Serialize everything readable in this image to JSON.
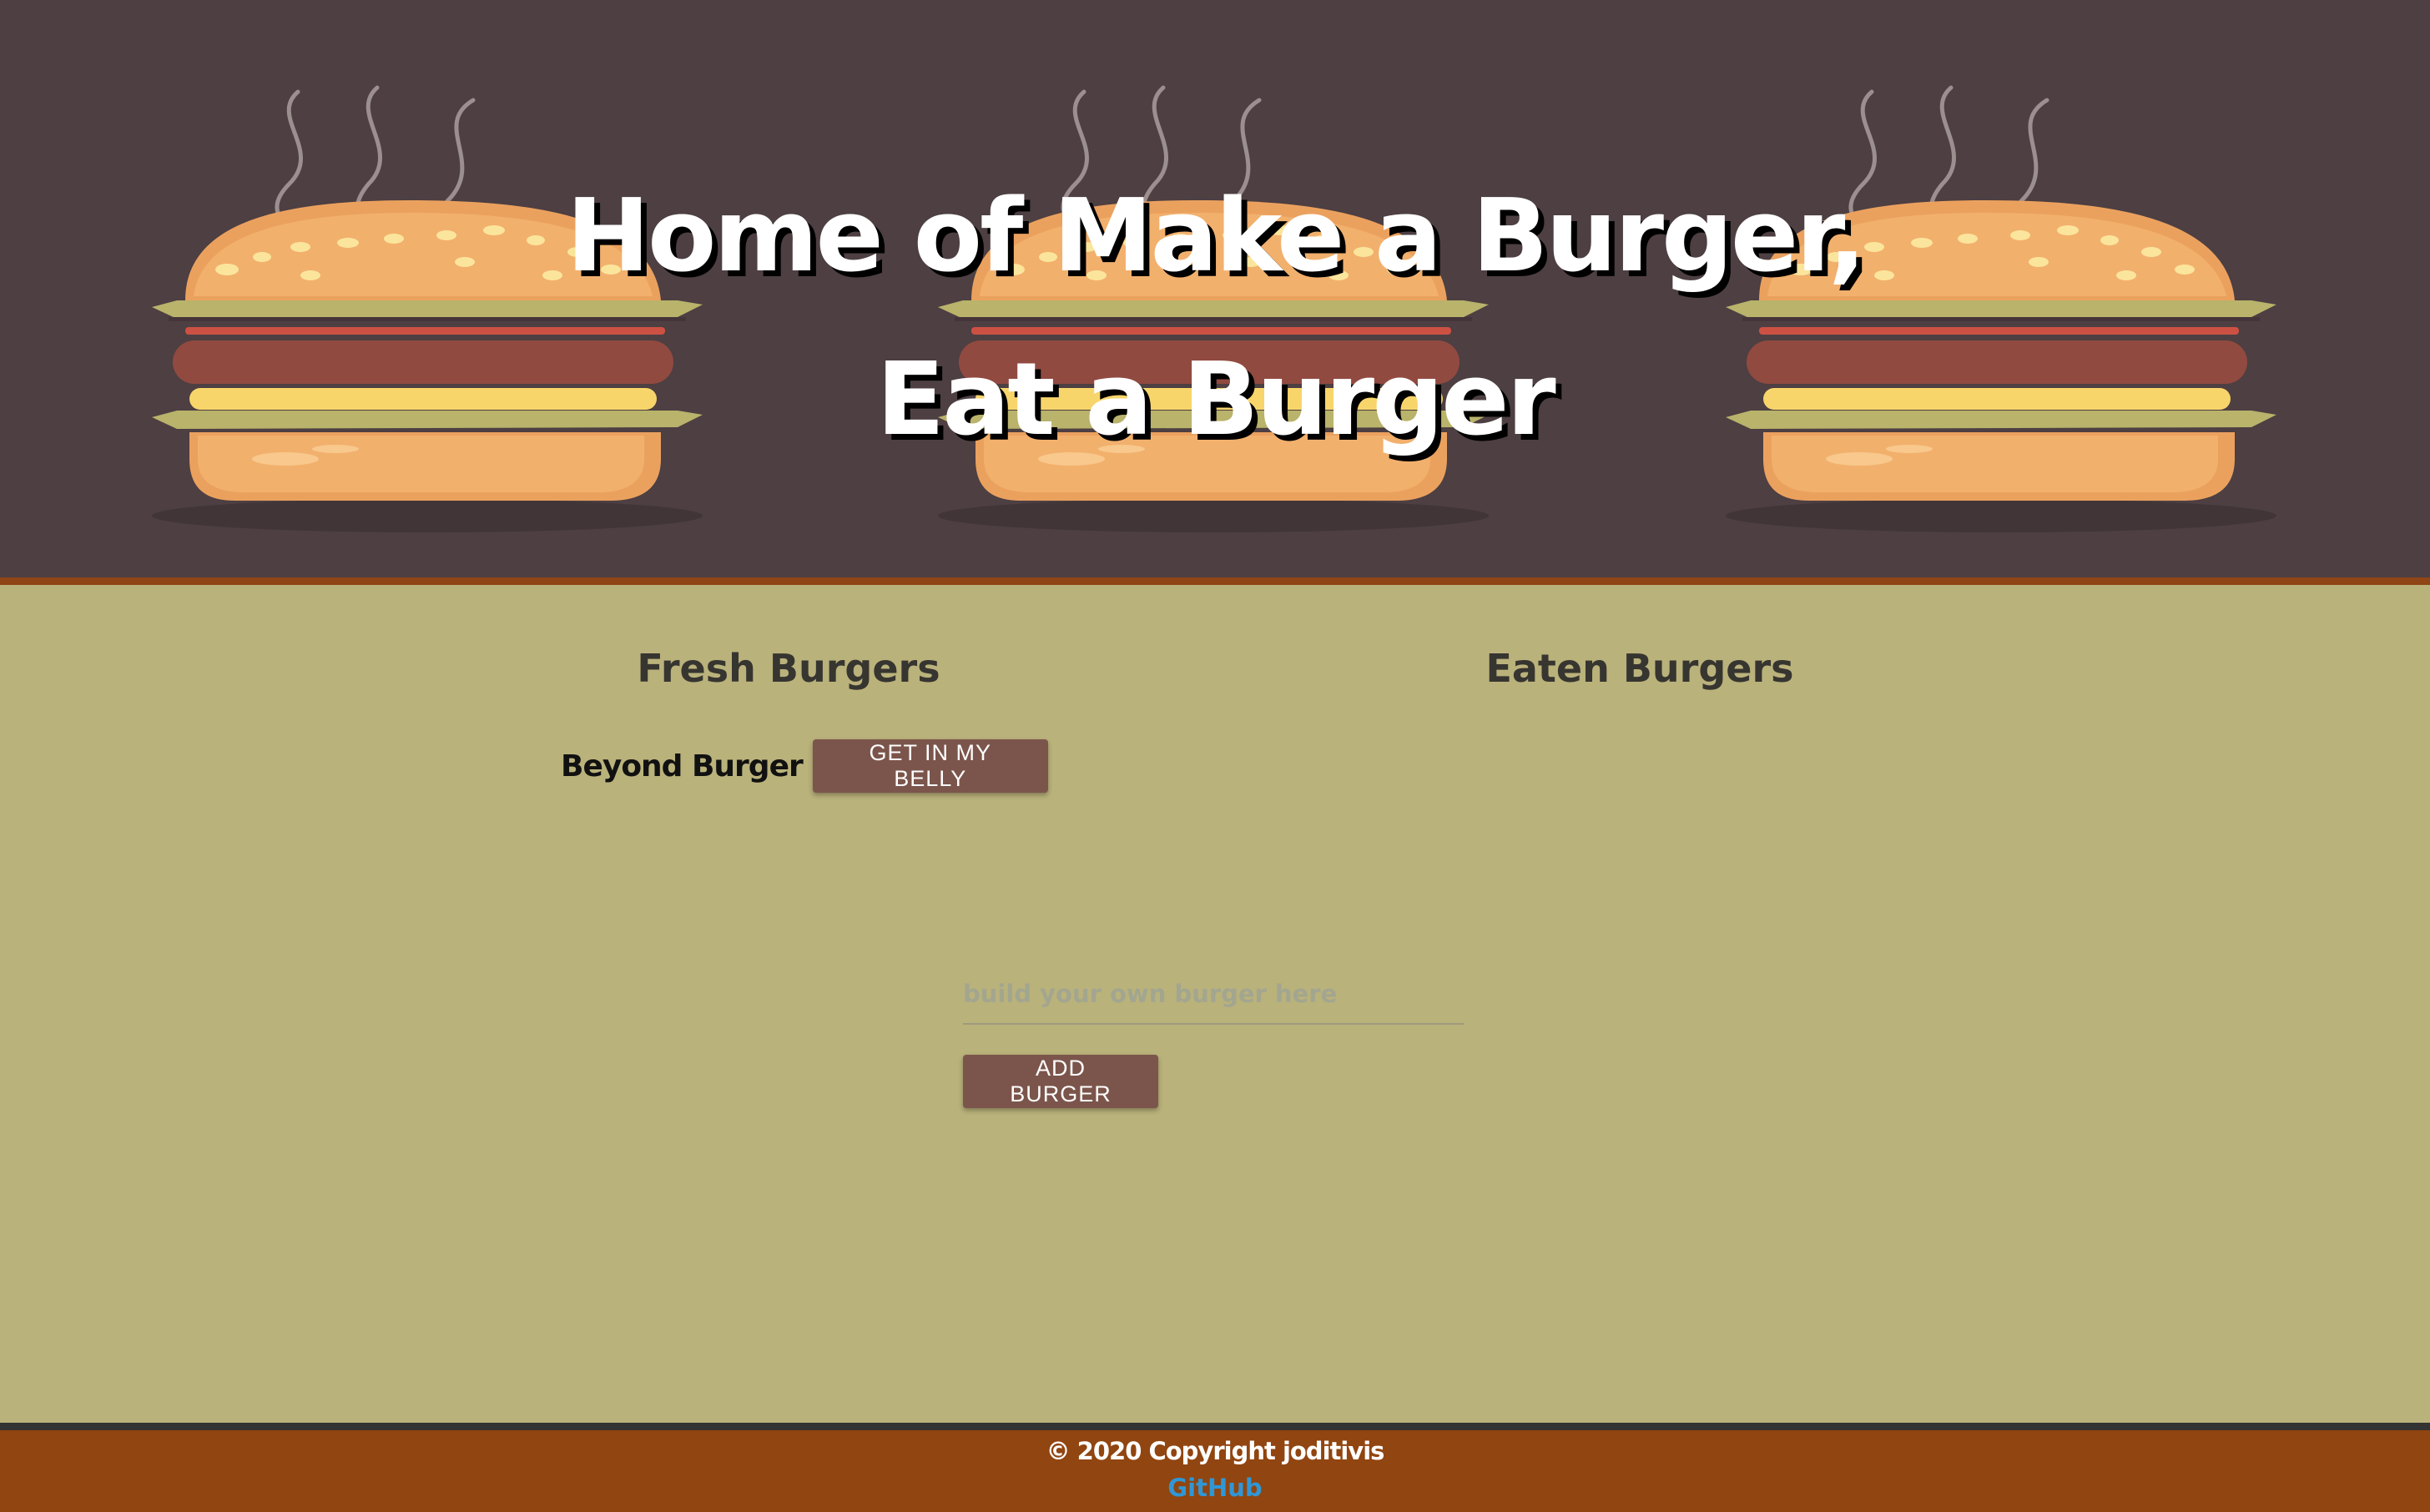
{
  "header": {
    "title_line1": "Home of Make a Burger,",
    "title_line2": "Eat a Burger",
    "background_color": "#4d3f42",
    "background_icons": [
      "burger-illustration",
      "burger-illustration",
      "burger-illustration"
    ]
  },
  "main": {
    "fresh_title": "Fresh Burgers",
    "eaten_title": "Eaten Burgers",
    "fresh_burgers": [
      {
        "name": "Beyond Burger",
        "button_label": "GET IN MY BELLY"
      }
    ],
    "eaten_burgers": [],
    "form": {
      "input_placeholder": "build your own burger here",
      "input_value": "",
      "submit_label": "ADD BURGER"
    },
    "background_color": "#bab27b",
    "button_color": "#7b554b"
  },
  "footer": {
    "copyright": "© 2020 Copyright joditivis",
    "link_label": "GitHub",
    "background_color": "#914510",
    "link_color": "#2f97d6"
  }
}
